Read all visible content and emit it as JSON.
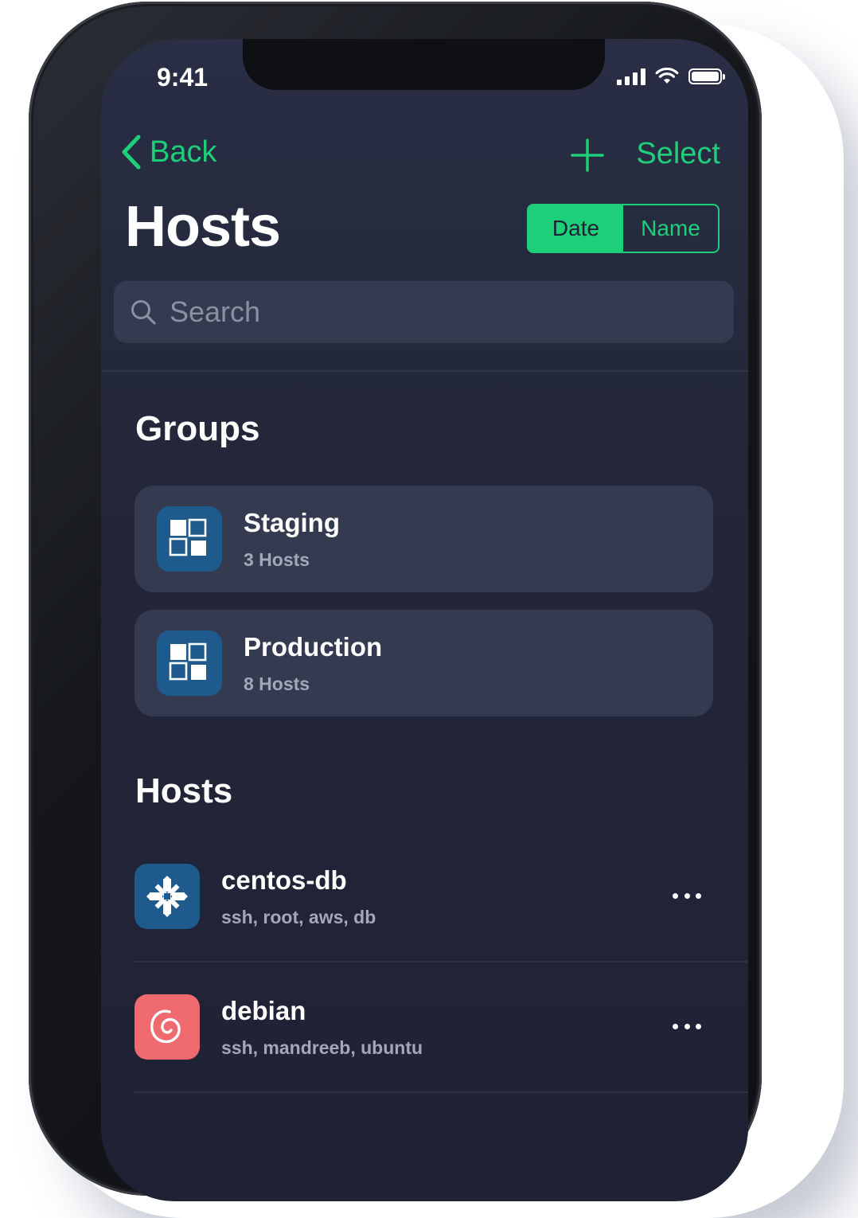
{
  "status_bar": {
    "time": "9:41"
  },
  "nav": {
    "back_label": "Back",
    "select_label": "Select",
    "add_icon": "plus-icon"
  },
  "header": {
    "title": "Hosts"
  },
  "sort": {
    "options": [
      "Date",
      "Name"
    ],
    "selected": "Date"
  },
  "search": {
    "placeholder": "Search"
  },
  "groups": {
    "title": "Groups",
    "items": [
      {
        "name": "Staging",
        "count": "3 Hosts",
        "icon": "group-icon"
      },
      {
        "name": "Production",
        "count": "8 Hosts",
        "icon": "group-icon"
      }
    ]
  },
  "hosts": {
    "title": "Hosts",
    "items": [
      {
        "name": "centos-db",
        "tags": "ssh, root, aws, db",
        "icon": "centos-icon",
        "icon_color": "#1e5a8c"
      },
      {
        "name": "debian",
        "tags": "ssh, mandreeb, ubuntu",
        "icon": "debian-icon",
        "icon_color": "#ef6a6f"
      }
    ]
  },
  "colors": {
    "accent": "#1ecf79",
    "background": "#232739",
    "card": "#343a50"
  }
}
